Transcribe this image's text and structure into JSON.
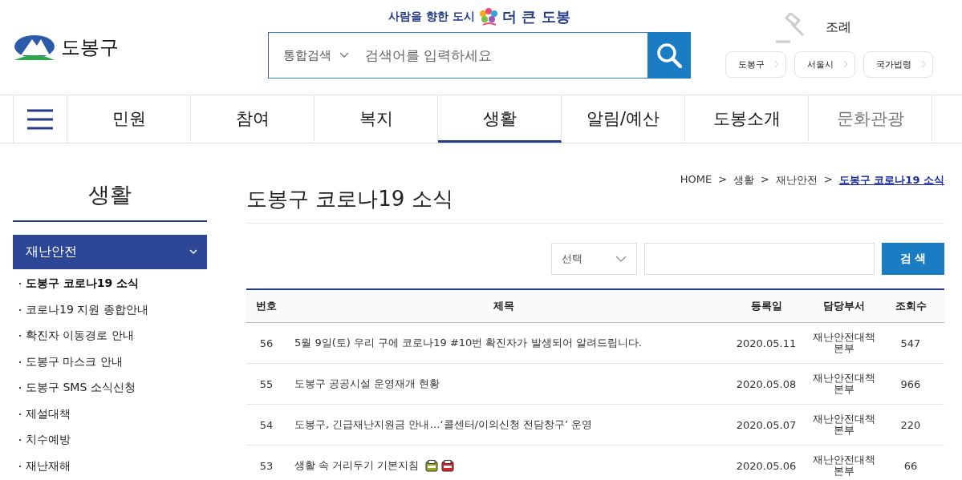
{
  "header": {
    "logo_text": "도봉구",
    "slogan": "사람을 향한 도시",
    "slogan_brand": "더 큰 도봉",
    "search": {
      "scope": "통합검색",
      "placeholder": "검색어를 입력하세요"
    },
    "ordinance": "조례",
    "law_links": [
      "도봉구",
      "서울시",
      "국가법령"
    ]
  },
  "nav": [
    {
      "label": "민원",
      "selected": false,
      "dimmed": false
    },
    {
      "label": "참여",
      "selected": false,
      "dimmed": false
    },
    {
      "label": "복지",
      "selected": false,
      "dimmed": false
    },
    {
      "label": "생활",
      "selected": true,
      "dimmed": false
    },
    {
      "label": "알림/예산",
      "selected": false,
      "dimmed": false
    },
    {
      "label": "도봉소개",
      "selected": false,
      "dimmed": false
    },
    {
      "label": "문화관광",
      "selected": false,
      "dimmed": true
    }
  ],
  "sidebar": {
    "title": "생활",
    "section": "재난안전",
    "items": [
      {
        "label": "도봉구 코로나19 소식",
        "selected": true
      },
      {
        "label": "코로나19 지원 종합안내",
        "selected": false
      },
      {
        "label": "확진자 이동경로 안내",
        "selected": false
      },
      {
        "label": "도봉구 마스크 안내",
        "selected": false
      },
      {
        "label": "도봉구 SMS 소식신청",
        "selected": false
      },
      {
        "label": "제설대책",
        "selected": false
      },
      {
        "label": "치수예방",
        "selected": false
      },
      {
        "label": "재난재해",
        "selected": false
      }
    ]
  },
  "breadcrumb": [
    "HOME",
    "생활",
    "재난안전",
    "도봉구 코로나19 소식"
  ],
  "breadcrumb_separator": ">",
  "page_title": "도봉구 코로나19 소식",
  "filter": {
    "select": "선택",
    "button": "검 색"
  },
  "table": {
    "columns": [
      "번호",
      "제목",
      "등록일",
      "담당부서",
      "조회수"
    ],
    "rows": [
      {
        "no": "56",
        "title": "5월 9일(토) 우리 구에 코로나19 #10번 확진자가 발생되어 알려드립니다.",
        "date": "2020.05.11",
        "dept": "재난안전대책 본부",
        "views": "547",
        "attachments": []
      },
      {
        "no": "55",
        "title": "도봉구 공공시설 운영재개 현황",
        "date": "2020.05.08",
        "dept": "재난안전대책 본부",
        "views": "966",
        "attachments": []
      },
      {
        "no": "54",
        "title": "도봉구, 긴급재난지원금 안내…‘콜센터/이의신청 전담창구’ 운영",
        "date": "2020.05.07",
        "dept": "재난안전대책 본부",
        "views": "220",
        "attachments": []
      },
      {
        "no": "53",
        "title": "생활 속 거리두기 기본지침",
        "date": "2020.05.06",
        "dept": "재난안전대책 본부",
        "views": "66",
        "attachments": [
          {
            "kind": "hwp"
          },
          {
            "kind": "pdf"
          }
        ]
      }
    ]
  }
}
